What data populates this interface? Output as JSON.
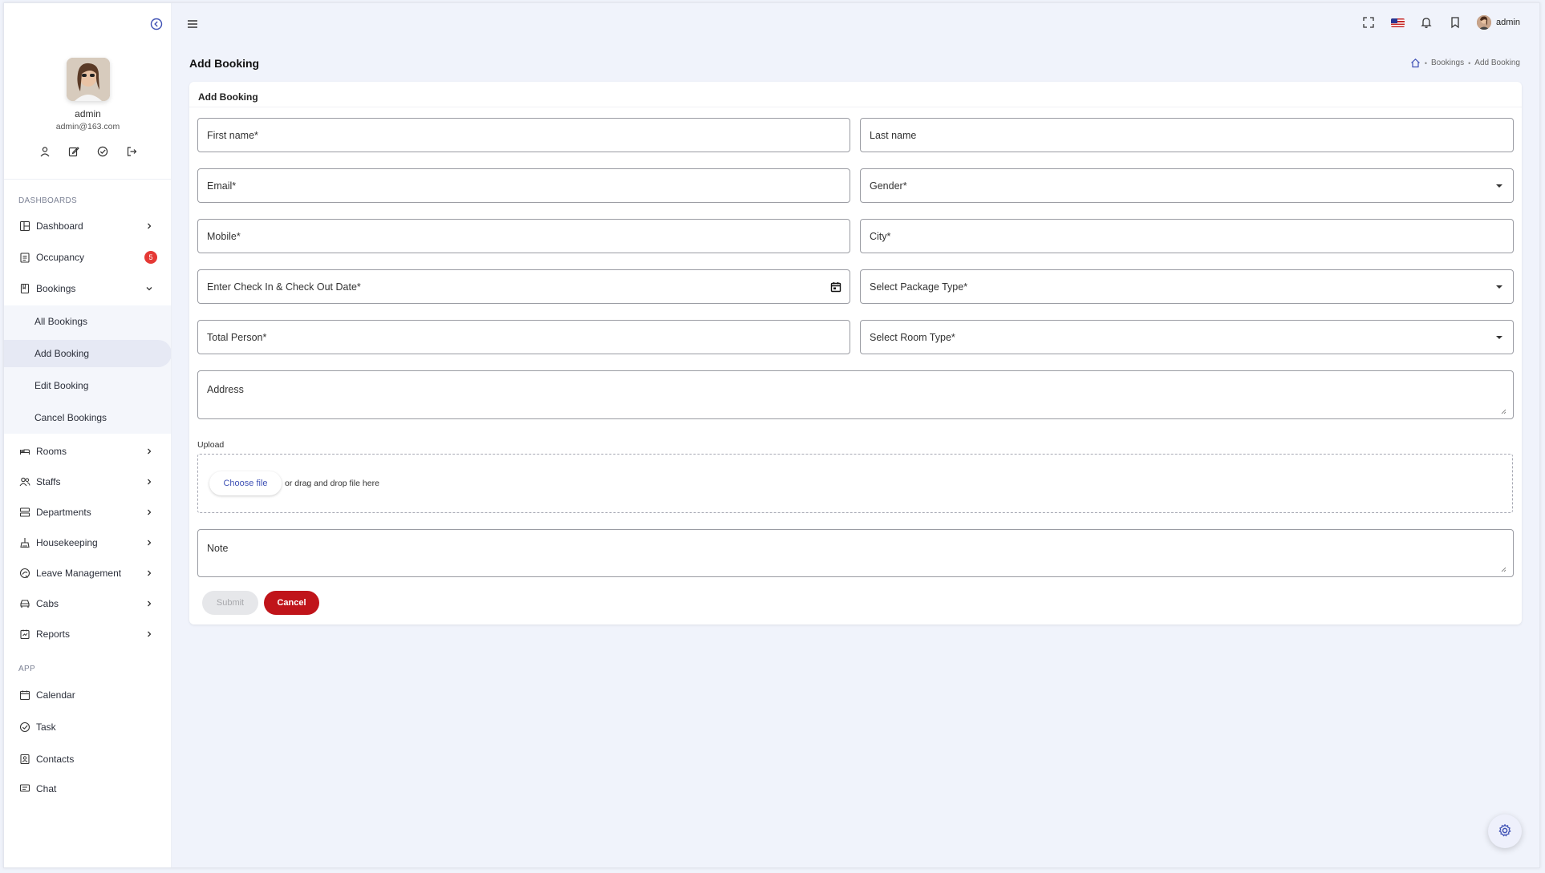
{
  "sidebar": {
    "profile": {
      "name": "admin",
      "email": "admin@163.com"
    },
    "sections": {
      "dashboards": "DASHBOARDS",
      "app": "APP"
    },
    "items": {
      "dashboard": "Dashboard",
      "occupancy": "Occupancy",
      "occupancy_badge": "5",
      "bookings": "Bookings",
      "rooms": "Rooms",
      "staffs": "Staffs",
      "departments": "Departments",
      "housekeeping": "Housekeeping",
      "leave_management": "Leave Management",
      "cabs": "Cabs",
      "reports": "Reports",
      "calendar": "Calendar",
      "task": "Task",
      "contacts": "Contacts",
      "chat": "Chat"
    },
    "bookings_sub": {
      "all": "All Bookings",
      "add": "Add Booking",
      "edit": "Edit Booking",
      "cancel": "Cancel Bookings"
    }
  },
  "topbar": {
    "user": "admin"
  },
  "page": {
    "title": "Add Booking",
    "breadcrumb": [
      "Bookings",
      "Add Booking"
    ]
  },
  "form": {
    "card_title": "Add Booking",
    "first_name": "First name*",
    "last_name": "Last name",
    "email": "Email*",
    "gender": "Gender*",
    "mobile": "Mobile*",
    "city": "City*",
    "dates": "Enter Check In & Check Out Date*",
    "package": "Select Package Type*",
    "total_person": "Total Person*",
    "room_type": "Select Room Type*",
    "address": "Address",
    "upload_label": "Upload",
    "choose_file": "Choose file",
    "drop_text": "or drag and drop file here",
    "note": "Note",
    "submit": "Submit",
    "cancel": "Cancel"
  },
  "colors": {
    "accent": "#3f51b5",
    "danger": "#c0141a",
    "badge": "#e53935",
    "page_bg": "#f0f3fb"
  },
  "icons": [
    "arrow-circle-left-icon",
    "menu-icon",
    "fullscreen-icon",
    "us-flag-icon",
    "bell-icon",
    "bookmark-icon",
    "settings-gear-icon",
    "calendar-icon",
    "dropdown-arrow-icon"
  ]
}
